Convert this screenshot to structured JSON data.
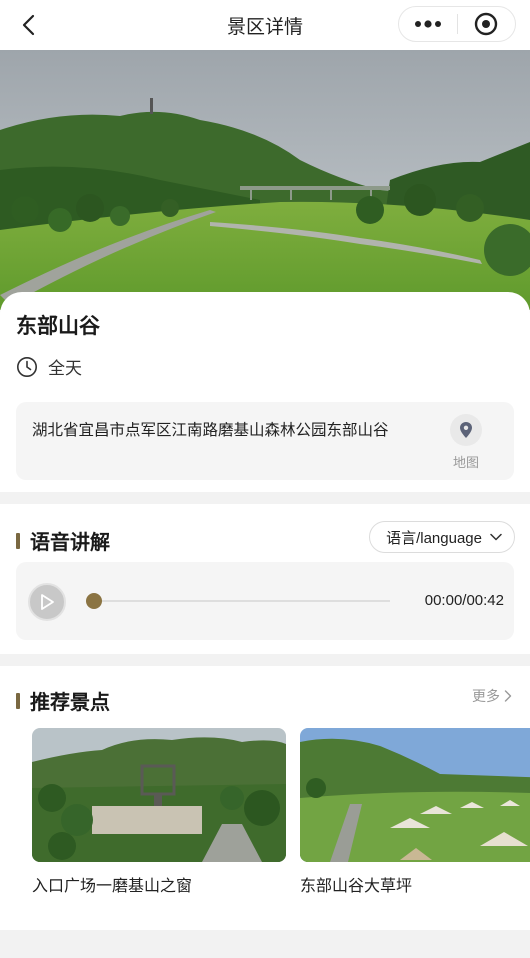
{
  "nav": {
    "title": "景区详情"
  },
  "spot": {
    "name": "东部山谷",
    "hours": "全天",
    "address": "湖北省宜昌市点军区江南路磨基山森林公园东部山谷",
    "map_label": "地图"
  },
  "audio": {
    "section_title": "语音讲解",
    "language_label": "语言/language",
    "time": "00:00/00:42",
    "progress": 0
  },
  "recommend": {
    "section_title": "推荐景点",
    "more_label": "更多",
    "items": [
      {
        "label": "入口广场一磨基山之窗"
      },
      {
        "label": "东部山谷大草坪"
      }
    ]
  },
  "colors": {
    "accent": "#8b7443",
    "section_bar": "#7a6841"
  }
}
